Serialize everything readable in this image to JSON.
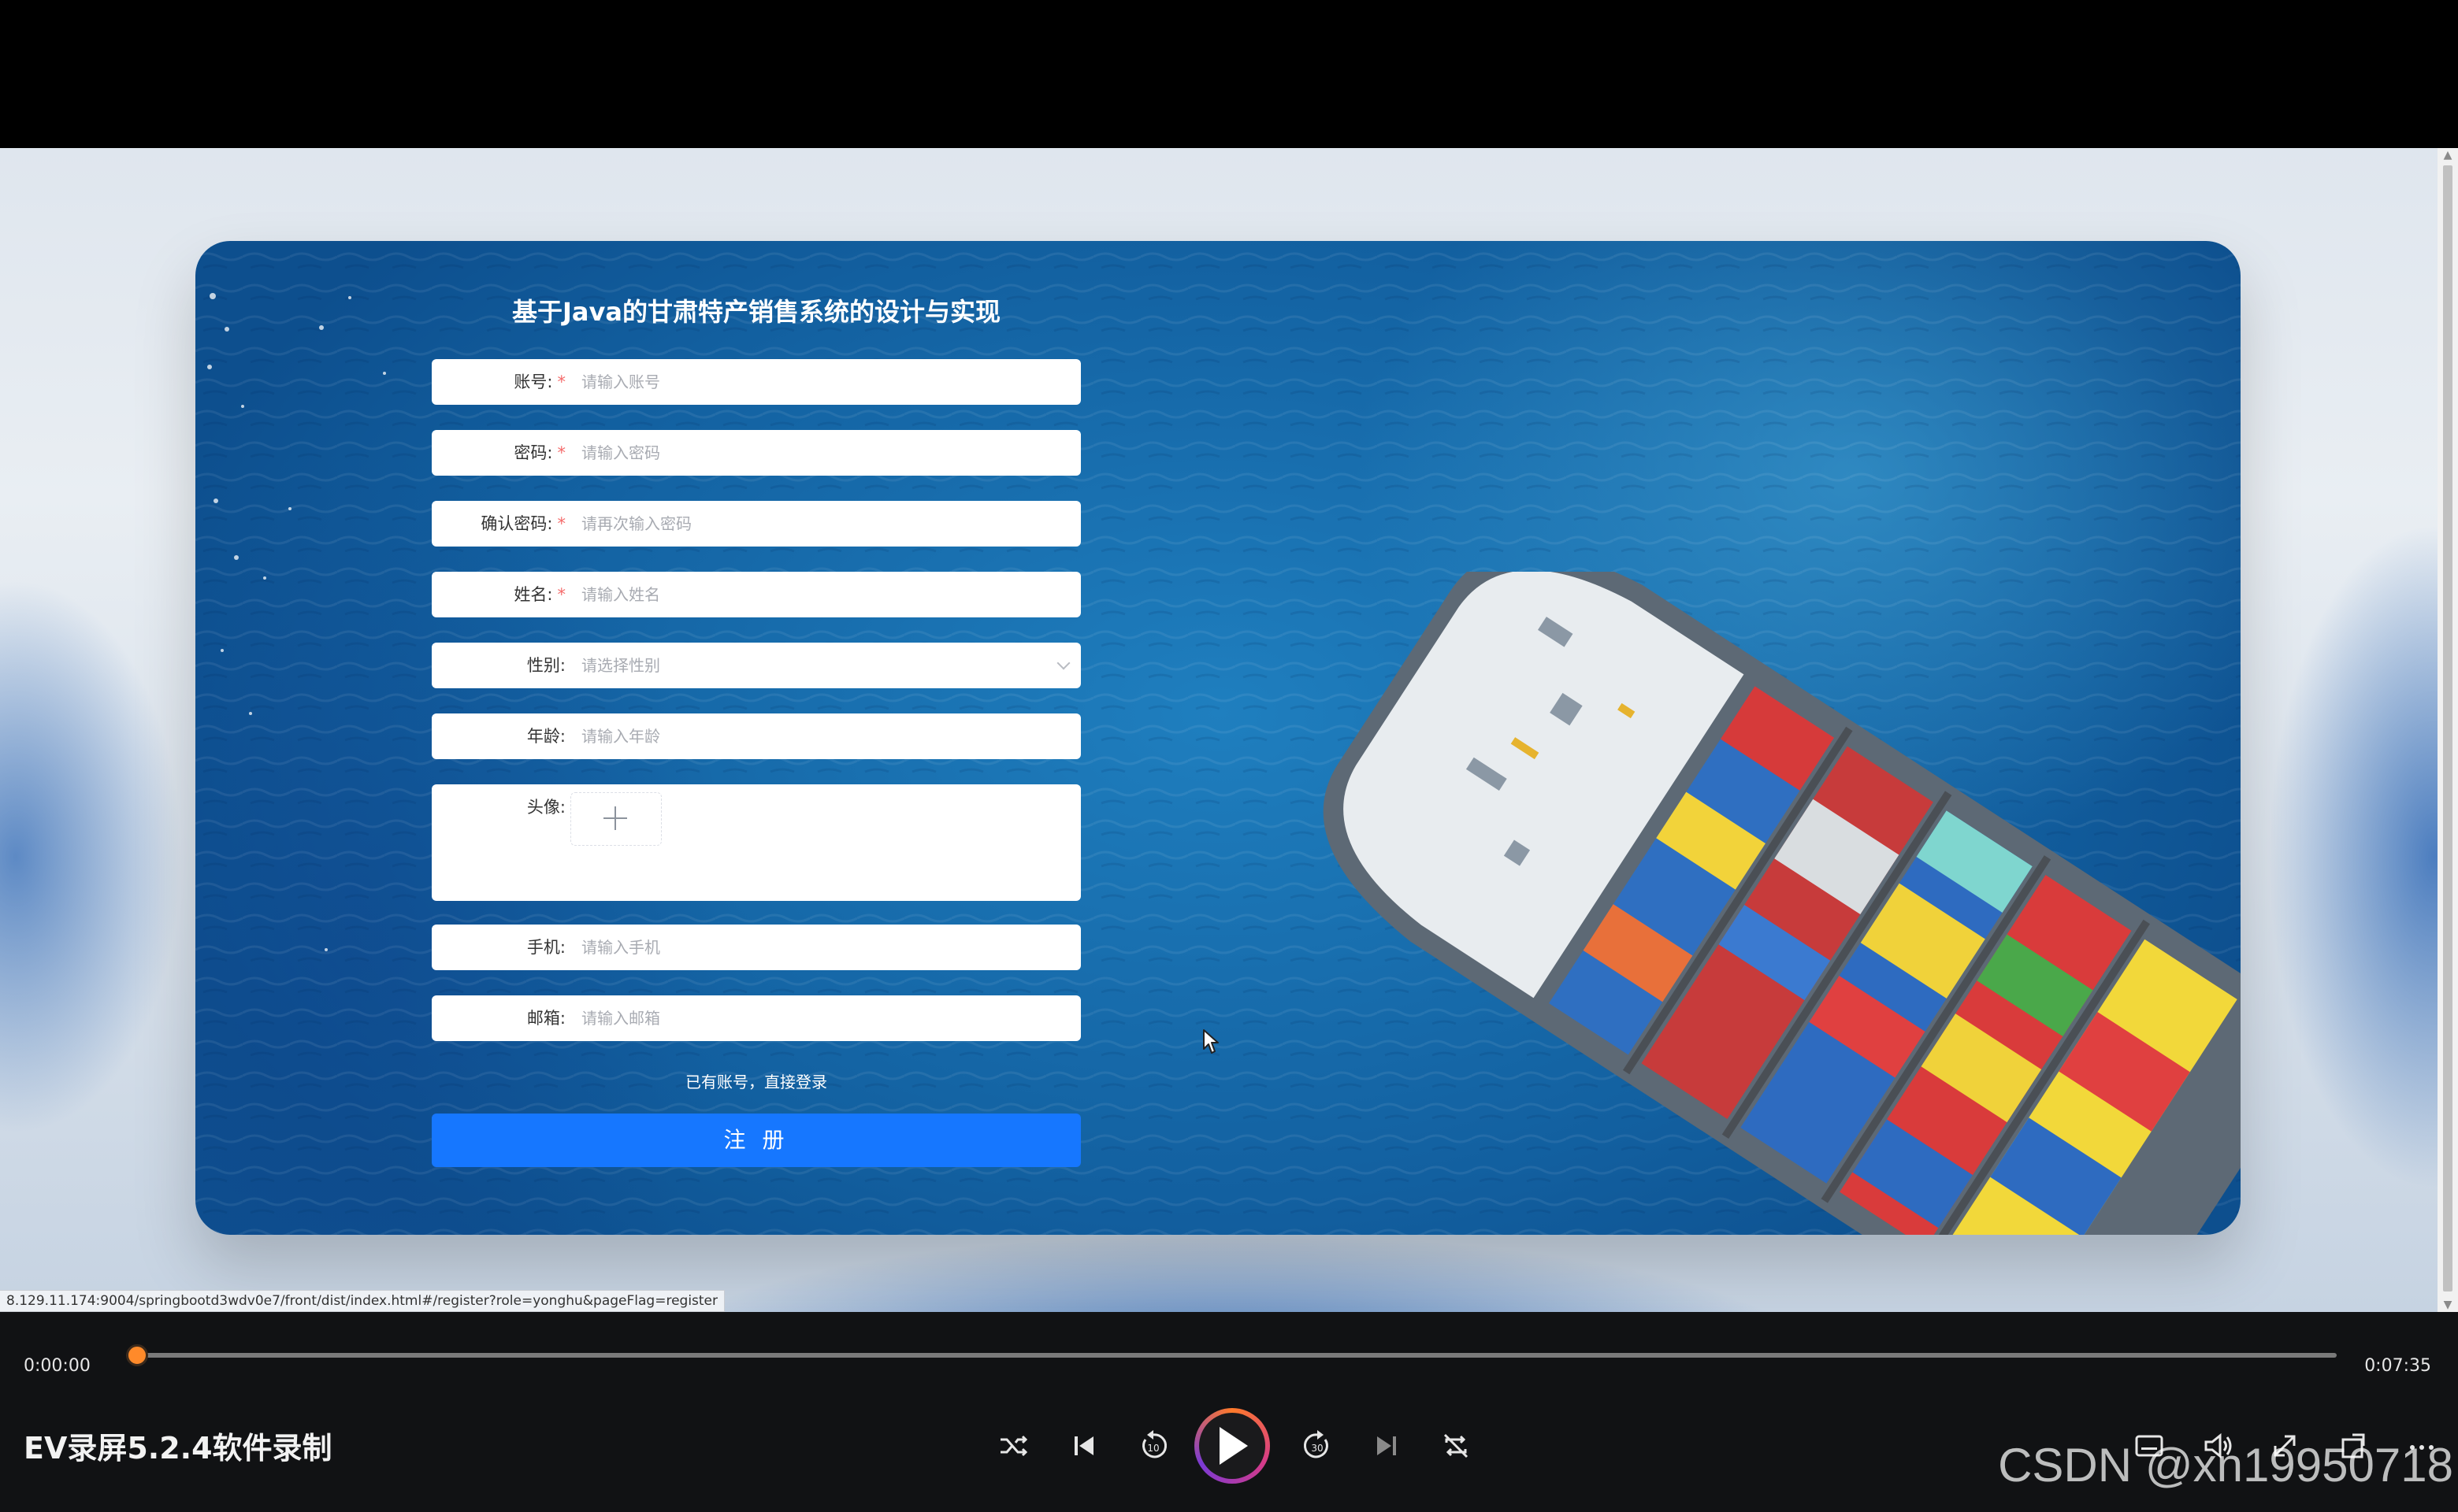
{
  "form": {
    "title": "基于Java的甘肃特产销售系统的设计与实现",
    "fields": [
      {
        "label": "账号:",
        "required": true,
        "placeholder": "请输入账号"
      },
      {
        "label": "密码:",
        "required": true,
        "placeholder": "请输入密码"
      },
      {
        "label": "确认密码:",
        "required": true,
        "placeholder": "请再次输入密码"
      },
      {
        "label": "姓名:",
        "required": true,
        "placeholder": "请输入姓名"
      },
      {
        "label": "性别:",
        "required": false,
        "placeholder": "请选择性别"
      },
      {
        "label": "年龄:",
        "required": false,
        "placeholder": "请输入年龄"
      },
      {
        "label": "头像:",
        "required": false,
        "placeholder": ""
      },
      {
        "label": "手机:",
        "required": false,
        "placeholder": "请输入手机"
      },
      {
        "label": "邮箱:",
        "required": false,
        "placeholder": "请输入邮箱"
      }
    ],
    "required_mark": "*",
    "login_link": "已有账号，直接登录",
    "submit_label": "注 册"
  },
  "status_url": "8.129.11.174:9004/springbootd3wdv0e7/front/dist/index.html#/register?role=yonghu&pageFlag=register",
  "player": {
    "current_time": "0:00:00",
    "total_time": "0:07:35",
    "progress": 0,
    "app_label": "EV录屏5.2.4软件录制",
    "accent_color": "#ff8a2a",
    "controls": [
      "shuffle-icon",
      "previous-icon",
      "rewind-10-icon",
      "play-icon",
      "forward-30-icon",
      "next-icon",
      "repeat-off-icon",
      "subtitles-icon",
      "volume-icon",
      "fullscreen-icon",
      "mini-window-icon",
      "more-icon"
    ]
  },
  "watermark": "CSDN @xn19950718",
  "colors": {
    "primary_button": "#1677ff",
    "required_star": "#f56c6c"
  }
}
